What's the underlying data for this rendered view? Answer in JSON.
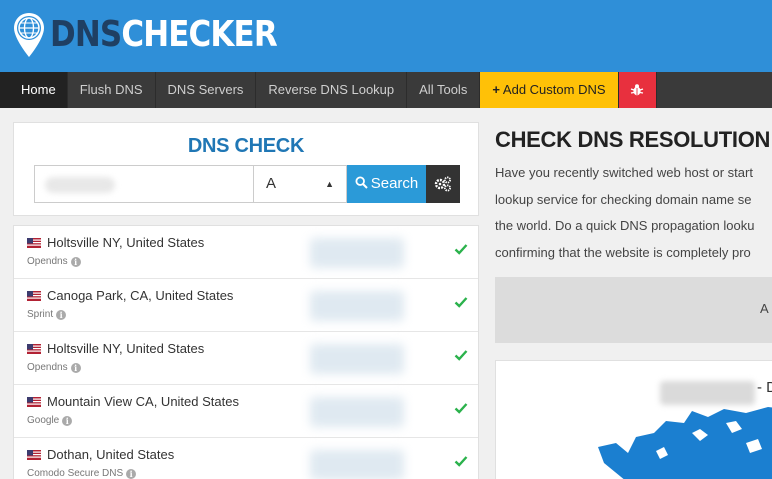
{
  "header": {
    "logo": {
      "dns": "DNS",
      "checker": "CHECKER"
    }
  },
  "nav": {
    "items": [
      "Home",
      "Flush DNS",
      "DNS Servers",
      "Reverse DNS Lookup",
      "All Tools"
    ],
    "add_custom": "Add Custom DNS",
    "bug_icon": "bug-icon"
  },
  "check": {
    "title": "DNS CHECK",
    "domain_value": "",
    "record_type": "A",
    "search_label": "Search",
    "settings_icon": "gears-icon"
  },
  "results": [
    {
      "location": "Holtsville NY, United States",
      "provider": "Opendns"
    },
    {
      "location": "Canoga Park, CA, United States",
      "provider": "Sprint"
    },
    {
      "location": "Holtsville NY, United States",
      "provider": "Opendns"
    },
    {
      "location": "Mountain View CA, United States",
      "provider": "Google"
    },
    {
      "location": "Dothan, United States",
      "provider": "Comodo Secure DNS"
    }
  ],
  "right": {
    "title": "CHECK DNS RESOLUTION",
    "desc_lines": [
      "Have you recently switched web host or start",
      "lookup service for checking domain name se",
      "the world. Do a quick DNS propagation looku",
      "confirming that the website is completely pro"
    ],
    "ad_text": "A",
    "map_text": "- D"
  },
  "colors": {
    "header": "#2f8fd8",
    "nav": "#3a3a3a",
    "accent_yellow": "#ffc107",
    "accent_red": "#e8303e",
    "title_blue": "#2077b5",
    "search_blue": "#2b9ad8",
    "check_green": "#2bb24c"
  }
}
